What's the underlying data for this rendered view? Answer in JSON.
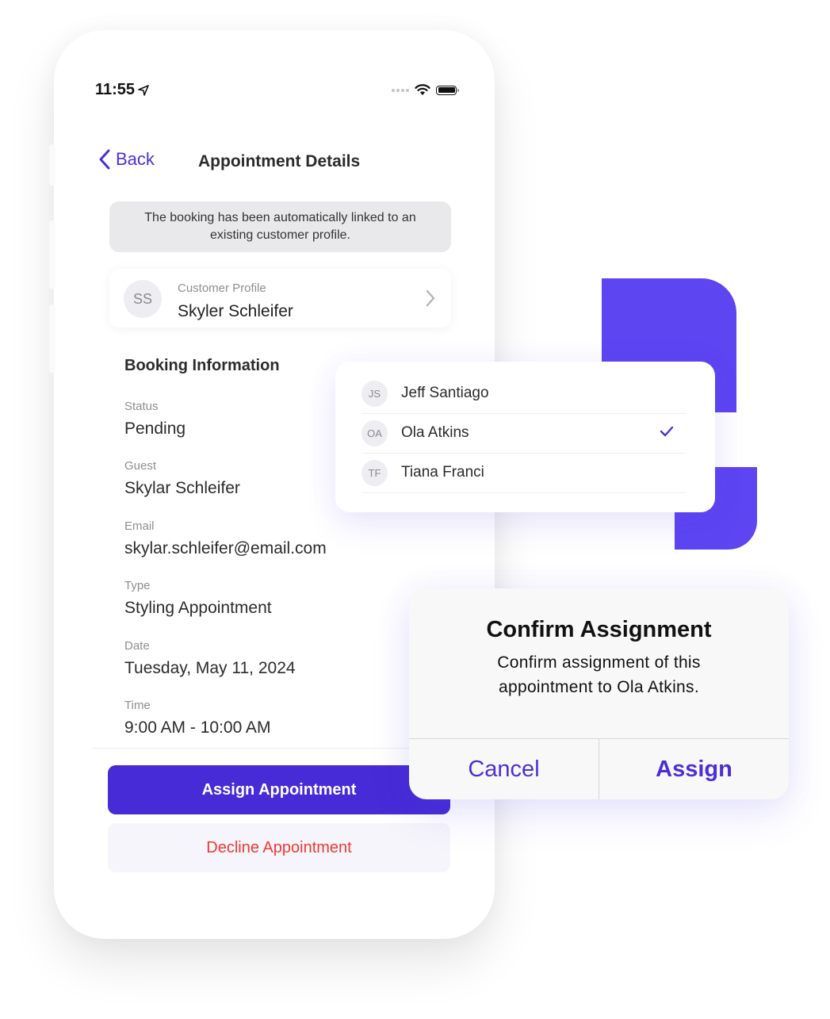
{
  "status_bar": {
    "time": "11:55",
    "location_icon": "location-arrow-icon",
    "signal_icon": "signal-dots-icon",
    "wifi_icon": "wifi-icon",
    "battery_icon": "battery-icon"
  },
  "nav": {
    "back_label": "Back",
    "title": "Appointment Details"
  },
  "notice": {
    "text": "The booking has been automatically linked to an existing customer profile."
  },
  "customer_profile": {
    "initials": "SS",
    "label": "Customer Profile",
    "name": "Skyler Schleifer"
  },
  "booking_info": {
    "title": "Booking Information",
    "fields": [
      {
        "label": "Status",
        "value": "Pending"
      },
      {
        "label": "Guest",
        "value": "Skylar Schleifer"
      },
      {
        "label": "Email",
        "value": "skylar.schleifer@email.com"
      },
      {
        "label": "Type",
        "value": "Styling Appointment"
      },
      {
        "label": "Date",
        "value": "Tuesday, May 11, 2024"
      },
      {
        "label": "Time",
        "value": "9:00 AM - 10:00 AM"
      }
    ]
  },
  "actions": {
    "assign_label": "Assign Appointment",
    "decline_label": "Decline Appointment"
  },
  "staff_picker": {
    "items": [
      {
        "initials": "JS",
        "name": "Jeff Santiago",
        "selected": false
      },
      {
        "initials": "OA",
        "name": "Ola Atkins",
        "selected": true
      },
      {
        "initials": "TF",
        "name": "Tiana Franci",
        "selected": false
      }
    ]
  },
  "confirm_dialog": {
    "title": "Confirm Assignment",
    "message": "Confirm assignment of this appointment to Ola Atkins.",
    "cancel_label": "Cancel",
    "confirm_label": "Assign"
  },
  "colors": {
    "accent": "#462bd6",
    "decoration": "#5e45f2",
    "destructive": "#ee3a32"
  }
}
